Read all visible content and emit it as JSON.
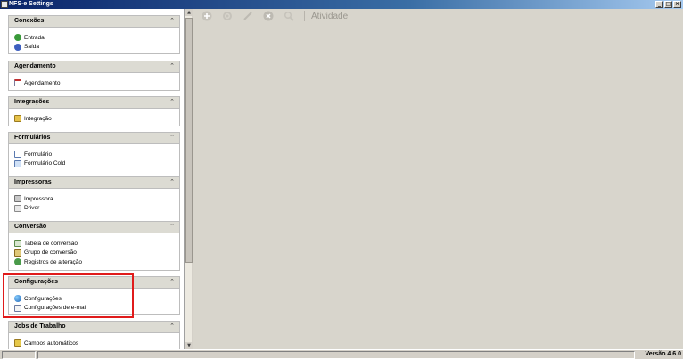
{
  "window": {
    "title": "NFS-e Settings",
    "minimize": "_",
    "maximize": "□",
    "close": "×"
  },
  "sections": [
    {
      "title": "Conexões",
      "items": [
        {
          "label": "Entrada",
          "icon": "entrada-icon"
        },
        {
          "label": "Saída",
          "icon": "saida-icon"
        }
      ]
    },
    {
      "title": "Agendamento",
      "items": [
        {
          "label": "Agendamento",
          "icon": "calendar-icon"
        }
      ]
    },
    {
      "title": "Integrações",
      "items": [
        {
          "label": "Integração",
          "icon": "integration-icon"
        }
      ]
    },
    {
      "title": "Formulários",
      "items": [
        {
          "label": "Formulário",
          "icon": "form-icon"
        },
        {
          "label": "Formulário Cold",
          "icon": "form-cold-icon"
        }
      ]
    },
    {
      "title": "Impressoras",
      "items": [
        {
          "label": "Impressora",
          "icon": "printer-icon"
        },
        {
          "label": "Driver",
          "icon": "driver-icon"
        }
      ]
    },
    {
      "title": "Conversão",
      "items": [
        {
          "label": "Tabela de conversão",
          "icon": "conversion-table-icon"
        },
        {
          "label": "Grupo de conversão",
          "icon": "conversion-group-icon"
        },
        {
          "label": "Registros de alteração",
          "icon": "change-log-icon"
        }
      ]
    },
    {
      "title": "Configurações",
      "items": [
        {
          "label": "Configurações",
          "icon": "globe-icon"
        },
        {
          "label": "Configurações de e-mail",
          "icon": "email-icon"
        }
      ]
    },
    {
      "title": "Jobs de Trabalho",
      "items": [
        {
          "label": "Campos automáticos",
          "icon": "auto-fields-icon"
        }
      ]
    }
  ],
  "toolbar": {
    "activity_label": "Atividade"
  },
  "status": {
    "version": "Versão 4.6.0"
  },
  "colors": {
    "highlight": "#e01b1b",
    "section_header": "#dcdbd3",
    "main_bg": "#d8d5cc"
  }
}
